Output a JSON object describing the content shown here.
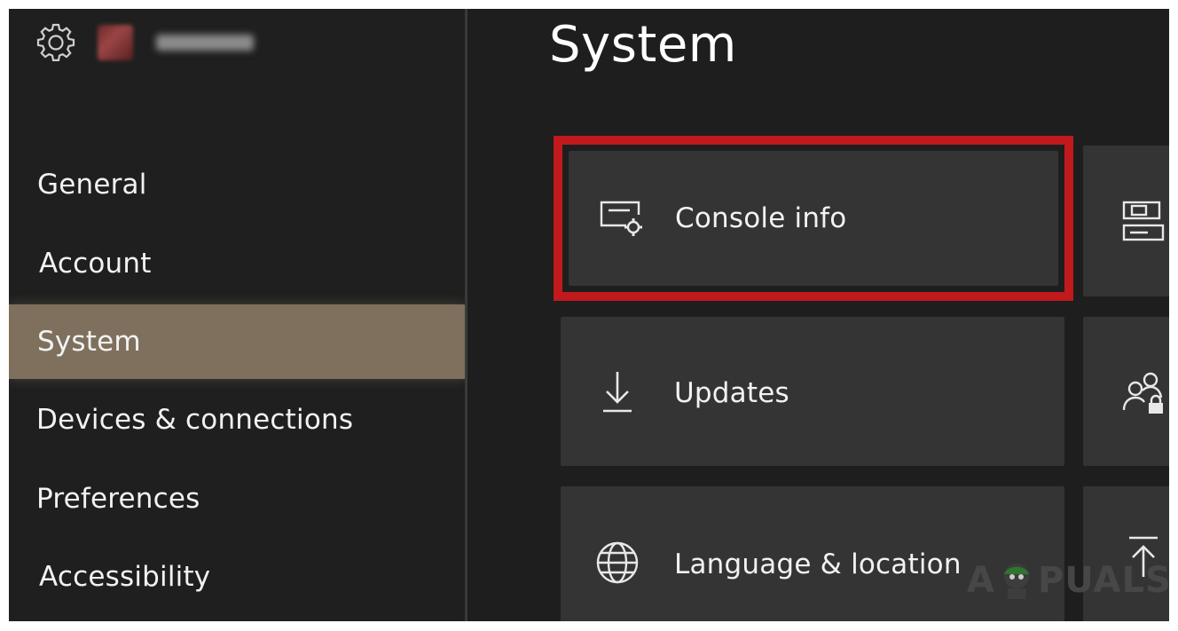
{
  "header": {
    "settings_icon": "gear-icon",
    "profile": {
      "avatar": "avatar-blurred",
      "gamertag_blurred": true
    }
  },
  "sidebar": {
    "items": [
      {
        "label": "General",
        "selected": false
      },
      {
        "label": "Account",
        "selected": false
      },
      {
        "label": "System",
        "selected": true
      },
      {
        "label": "Devices & connections",
        "selected": false
      },
      {
        "label": "Preferences",
        "selected": false
      },
      {
        "label": "Accessibility",
        "selected": false
      }
    ],
    "selected_color": "#7f705d"
  },
  "main": {
    "title": "System",
    "tiles": [
      {
        "label": "Console info",
        "icon": "console-settings-icon",
        "highlighted": true
      },
      {
        "label": "Updates",
        "icon": "download-arrow-icon",
        "highlighted": false
      },
      {
        "label": "Language & location",
        "icon": "globe-icon",
        "highlighted": false
      }
    ],
    "side_tiles": [
      {
        "icon": "storage-devices-icon"
      },
      {
        "icon": "users-lock-icon"
      },
      {
        "icon": "upload-arrow-icon"
      }
    ],
    "highlight_color": "#c1191c"
  },
  "watermark": {
    "text_left": "A",
    "text_right": "PUALS"
  }
}
